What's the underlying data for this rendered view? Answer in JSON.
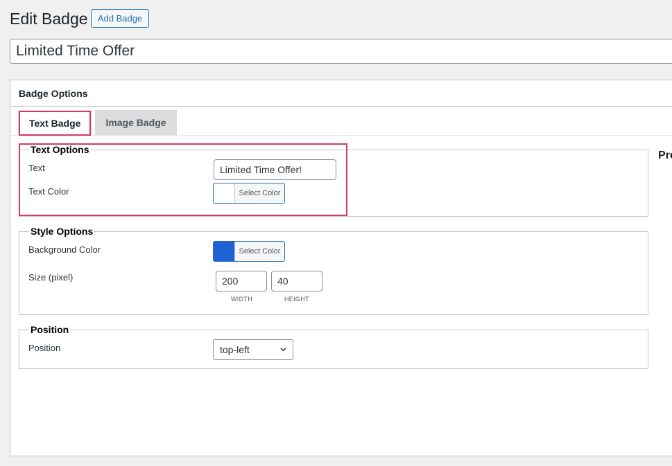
{
  "header": {
    "title": "Edit Badge",
    "add_button": "Add Badge"
  },
  "badge_title": "Limited Time Offer",
  "postbox": {
    "title": "Badge Options",
    "tabs": [
      {
        "label": "Text Badge",
        "active": true
      },
      {
        "label": "Image Badge",
        "active": false
      }
    ],
    "preview_label": "Pre"
  },
  "text_options": {
    "legend": "Text Options",
    "text_label": "Text",
    "text_value": "Limited Time Offer!",
    "color_label": "Text Color",
    "color_button": "Select Color",
    "color_value": "#ffffff"
  },
  "style_options": {
    "legend": "Style Options",
    "bg_label": "Background Color",
    "bg_button": "Select Color",
    "bg_value": "#1e62d6",
    "size_label": "Size (pixel)",
    "width_value": "200",
    "height_value": "40",
    "width_caption": "WIDTH",
    "height_caption": "HEIGHT"
  },
  "position": {
    "legend": "Position",
    "label": "Position",
    "selected": "top-left"
  },
  "colors": {
    "accent": "#2271b1",
    "highlight": "#d63864"
  }
}
